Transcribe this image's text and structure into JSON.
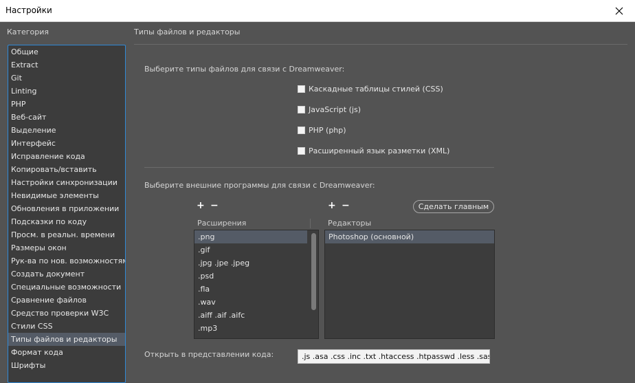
{
  "window": {
    "title": "Настройки"
  },
  "sidebar": {
    "label": "Категория",
    "items": [
      {
        "label": "Общие"
      },
      {
        "label": "Extract"
      },
      {
        "label": "Git"
      },
      {
        "label": "Linting"
      },
      {
        "label": "PHP"
      },
      {
        "label": "Веб-сайт"
      },
      {
        "label": "Выделение"
      },
      {
        "label": "Интерфейс"
      },
      {
        "label": "Исправление кода"
      },
      {
        "label": "Копировать/вставить"
      },
      {
        "label": "Настройки синхронизации"
      },
      {
        "label": "Невидимые элементы"
      },
      {
        "label": "Обновления в приложении"
      },
      {
        "label": "Подсказки по коду"
      },
      {
        "label": "Просм. в реальн. времени"
      },
      {
        "label": "Размеры окон"
      },
      {
        "label": "Рук-ва по нов. возможностям"
      },
      {
        "label": "Создать документ"
      },
      {
        "label": "Специальные возможности"
      },
      {
        "label": "Сравнение файлов"
      },
      {
        "label": "Средство проверки W3C"
      },
      {
        "label": "Стили CSS"
      },
      {
        "label": "Типы файлов и редакторы",
        "selected": true
      },
      {
        "label": "Формат кода"
      },
      {
        "label": "Шрифты"
      }
    ]
  },
  "main": {
    "title": "Типы файлов и редакторы",
    "file_types_prompt": "Выберите типы файлов для связи с Dreamweaver:",
    "checkboxes": [
      {
        "label": "Каскадные таблицы стилей (CSS)",
        "checked": false
      },
      {
        "label": "JavaScript (js)",
        "checked": false
      },
      {
        "label": "PHP (php)",
        "checked": false
      },
      {
        "label": "Расширенный язык разметки (XML)",
        "checked": false
      }
    ],
    "external_prompt": "Выберите внешние программы для связи с Dreamweaver:",
    "plus": "+",
    "minus": "−",
    "make_primary_label": "Сделать главным",
    "extensions_header": "Расширения",
    "editors_header": "Редакторы",
    "extensions": [
      ".png",
      ".gif",
      ".jpg .jpe .jpeg",
      ".psd",
      ".fla",
      ".wav",
      ".aiff .aif .aifc",
      ".mp3"
    ],
    "selected_extension": 0,
    "editors": [
      {
        "label": "Photoshop (основной)",
        "selected": true
      }
    ],
    "code_view_label": "Открыть в представлении кода:",
    "code_view_value": ".js .asa .css .inc .txt .htaccess .htpasswd .less .sass .scss"
  }
}
